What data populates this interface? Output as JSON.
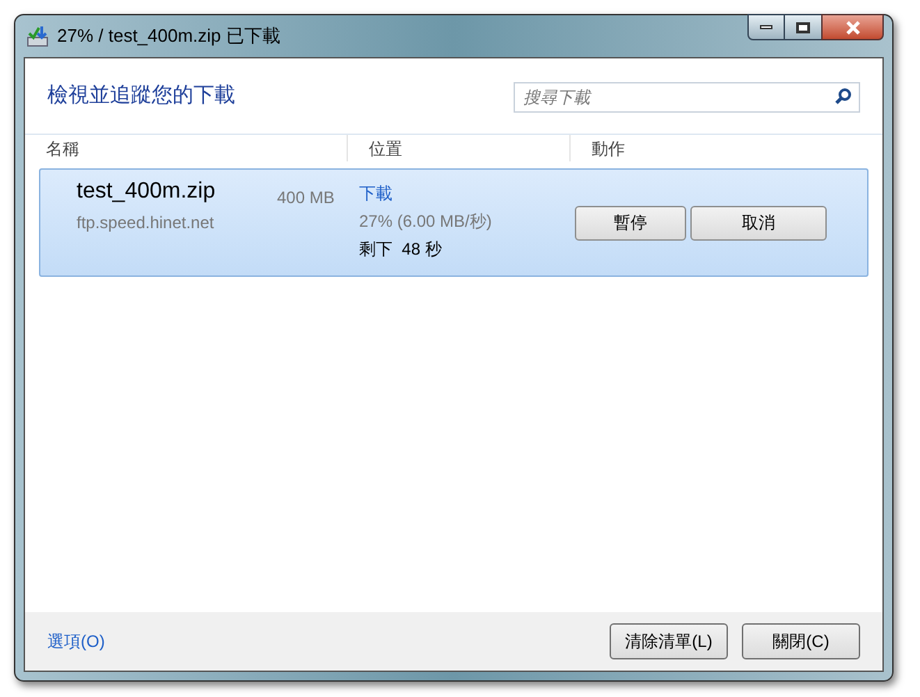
{
  "window": {
    "title": "27% / test_400m.zip 已下載"
  },
  "header": {
    "heading": "檢視並追蹤您的下載",
    "search": {
      "placeholder": "搜尋下載"
    }
  },
  "table": {
    "columns": [
      "名稱",
      "位置",
      "動作"
    ],
    "rows": [
      {
        "selected": true,
        "file_name": "test_400m.zip",
        "size": "400 MB",
        "source": "ftp.speed.hinet.net",
        "status": "下載",
        "progress": "27% (6.00 MB/秒)",
        "remaining": "剩下  48 秒",
        "actions": [
          "暫停",
          "取消"
        ]
      }
    ]
  },
  "footer": {
    "options_link": "選項(O)",
    "buttons": [
      "清除清單(L)",
      "關閉(C)"
    ]
  }
}
